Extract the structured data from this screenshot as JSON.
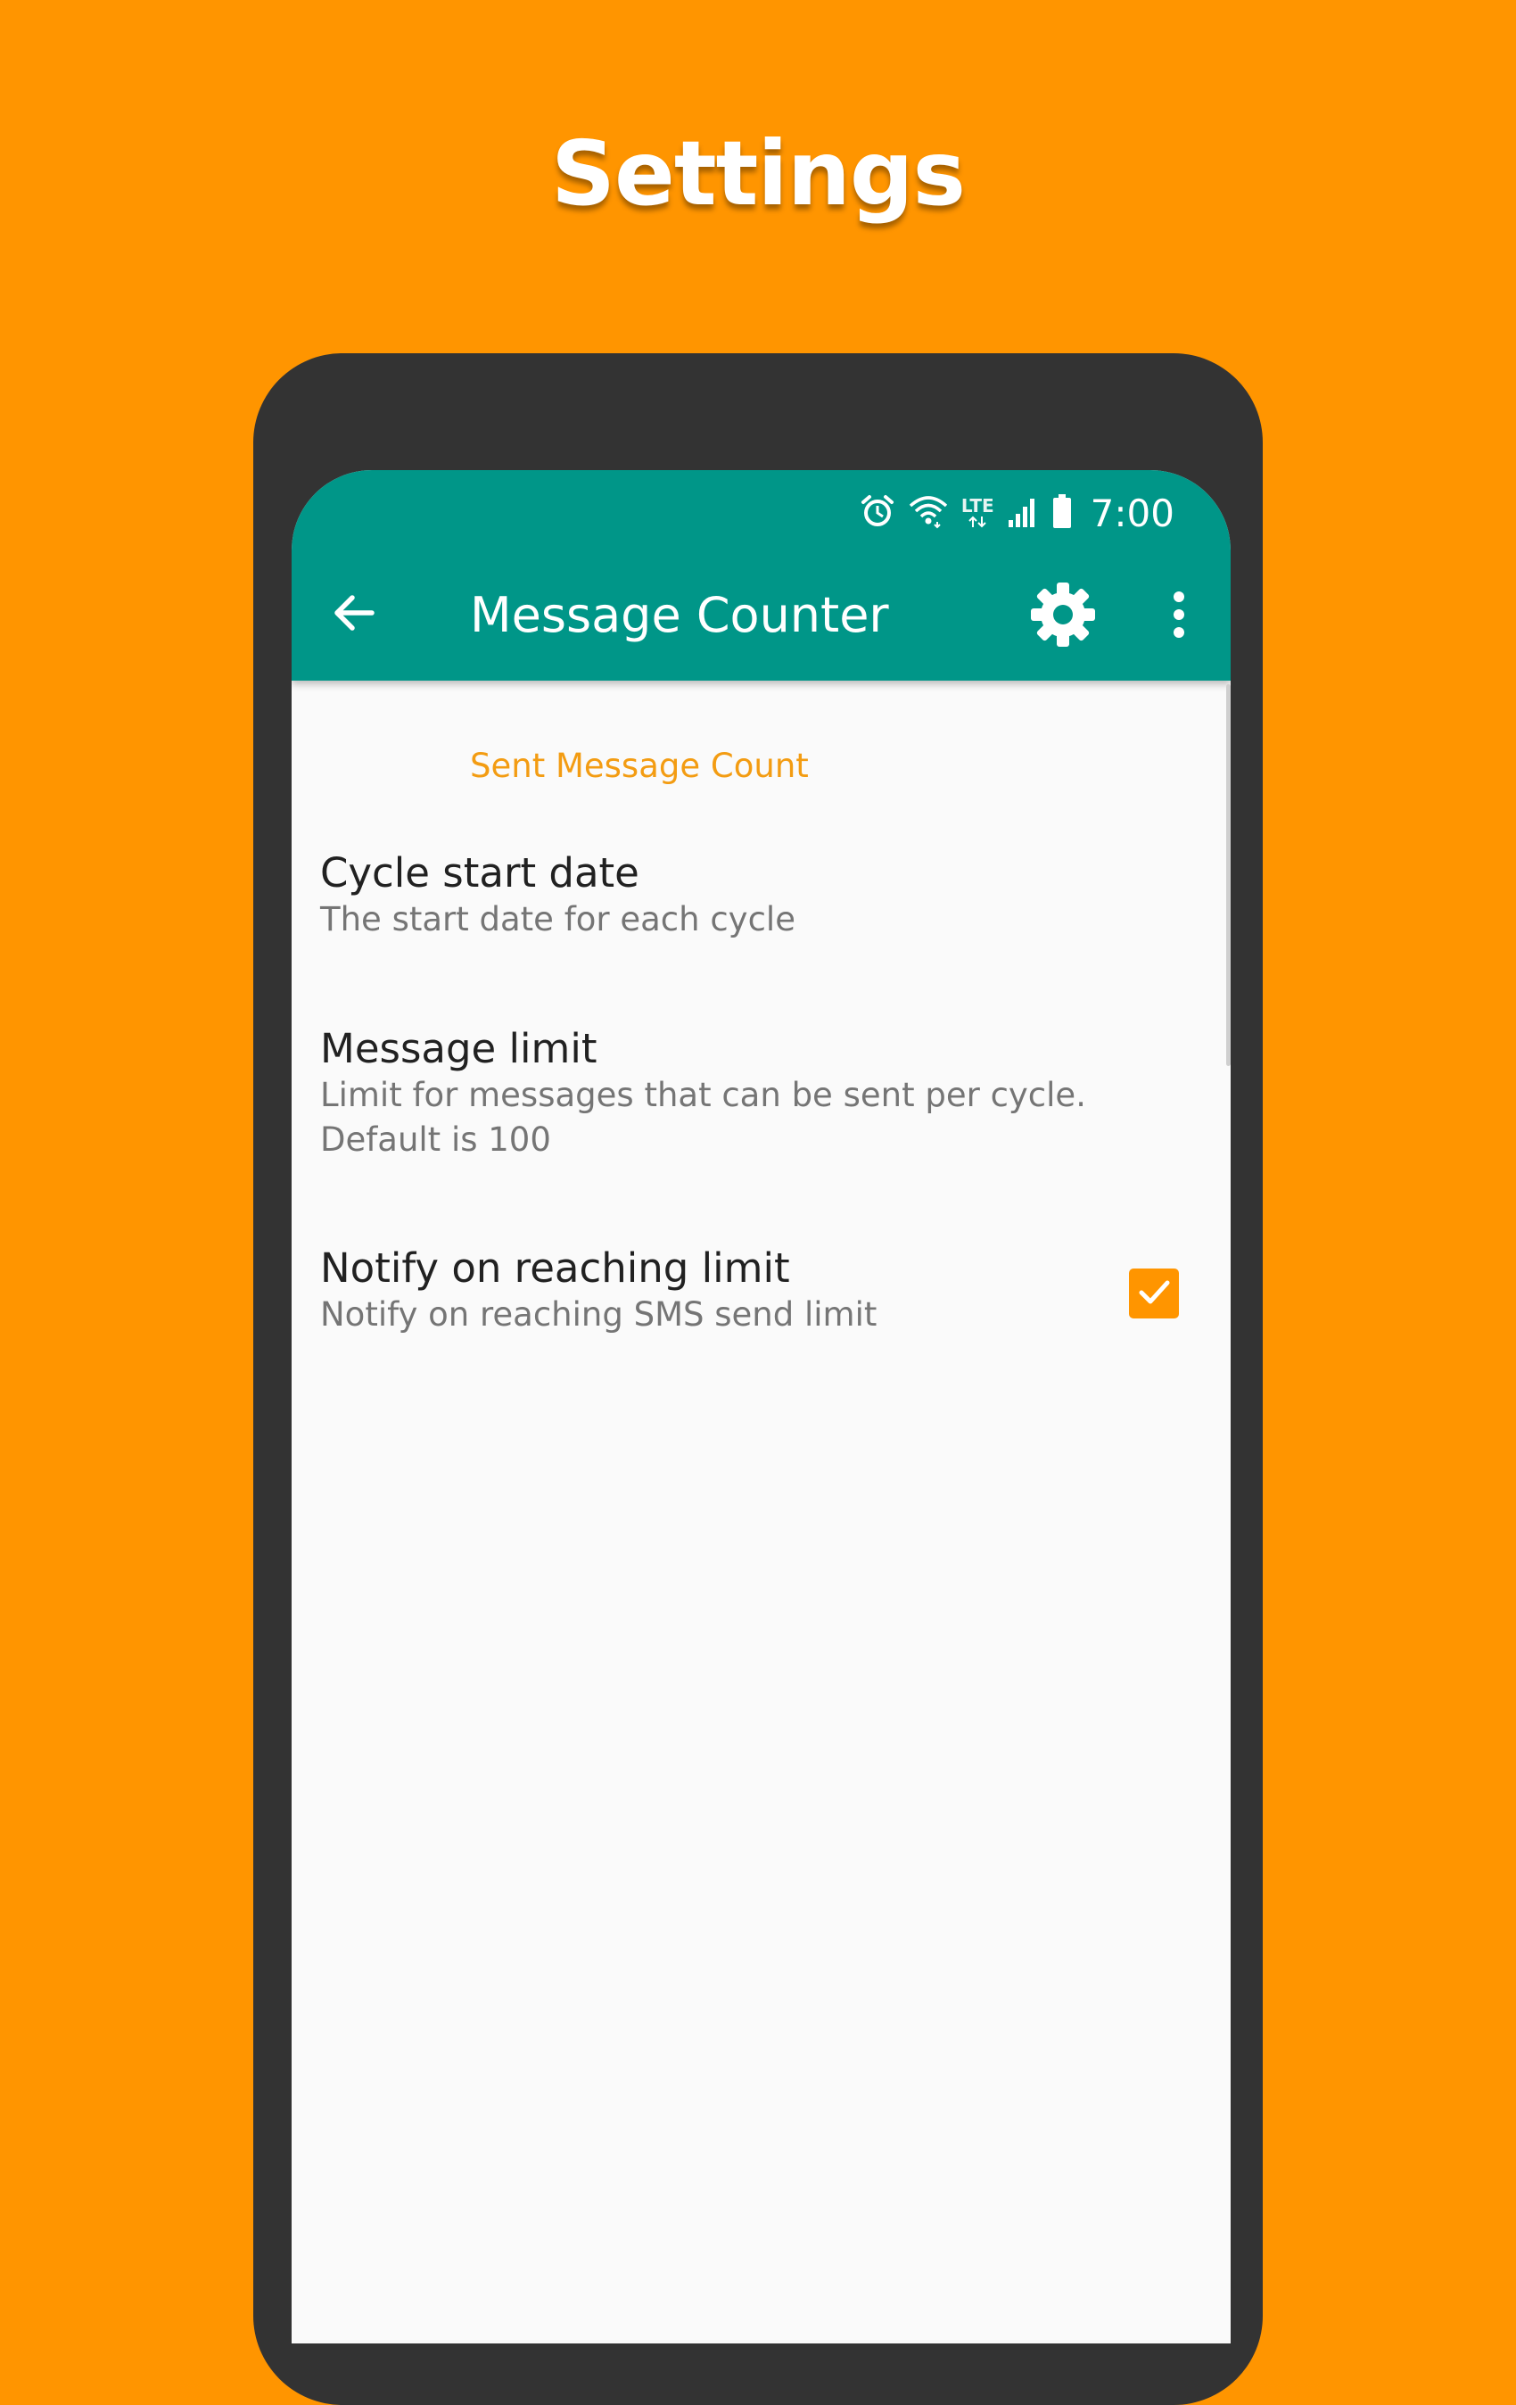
{
  "promo": {
    "title": "Settings"
  },
  "status_bar": {
    "icons": [
      "alarm-icon",
      "wifi-icon",
      "lte-icon",
      "signal-icon",
      "battery-icon"
    ],
    "lte_label": "LTE",
    "time": "7:00"
  },
  "toolbar": {
    "title": "Message Counter",
    "back_icon": "arrow-back-icon",
    "settings_icon": "gear-icon",
    "more_icon": "more-vert-icon"
  },
  "settings": {
    "category": "Sent Message Count",
    "items": [
      {
        "title": "Cycle start date",
        "summary": "The start date for each cycle"
      },
      {
        "title": "Message limit",
        "summary": "Limit for messages that can be sent per cycle. Default is 100"
      },
      {
        "title": "Notify on reaching limit",
        "summary": "Notify on reaching SMS send limit",
        "checked": true
      }
    ]
  },
  "colors": {
    "background": "#FF9500",
    "appbar": "#009688",
    "accent": "#F39C12",
    "phone_frame": "#333333",
    "screen": "#FAFAFA"
  }
}
